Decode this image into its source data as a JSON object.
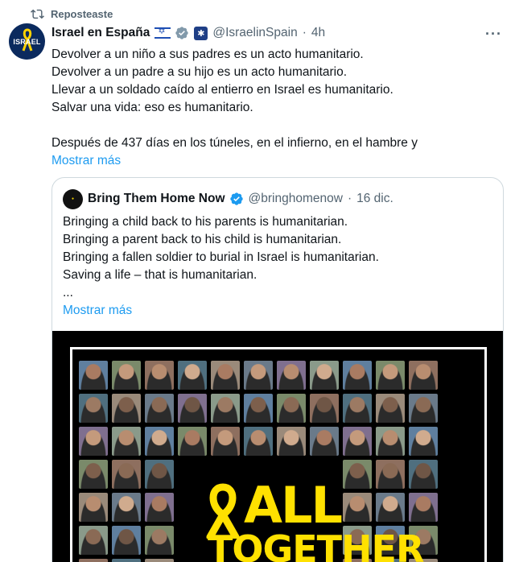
{
  "repost": {
    "label": "Reposteaste",
    "icon": "repost-icon"
  },
  "tweet": {
    "author_name": "Israel en España",
    "handle": "@IsraelinSpain",
    "separator": "·",
    "time": "4h",
    "avatar_text": "ISRAEL",
    "menu": "···",
    "lines": [
      "Devolver a un niño a sus padres es un acto humanitario.",
      "Devolver a un padre a su hijo es un acto humanitario.",
      "Llevar a un soldado caído al entierro en Israel es humanitario.",
      "Salvar una vida: eso es humanitario.",
      "",
      "Después de 437 días en los túneles, en el infierno, en el hambre y"
    ],
    "show_more": "Mostrar más"
  },
  "quote": {
    "author_name": "Bring Them Home Now",
    "handle": "@bringhomenow",
    "separator": "·",
    "time": "16 dic.",
    "lines": [
      "Bringing a child back to his parents is humanitarian.",
      "Bringing a parent back to his child is humanitarian.",
      "Bringing a fallen soldier to burial in Israel is humanitarian.",
      "Saving a life – that is humanitarian.",
      "..."
    ],
    "show_more": "Mostrar más",
    "poster": {
      "word1": "ALL",
      "word2": "TOGETHER"
    }
  },
  "colors": {
    "link": "#1d9bf0",
    "secondary_text": "#536471",
    "verified": "#1d9bf0",
    "poster_yellow": "#ffe100"
  }
}
